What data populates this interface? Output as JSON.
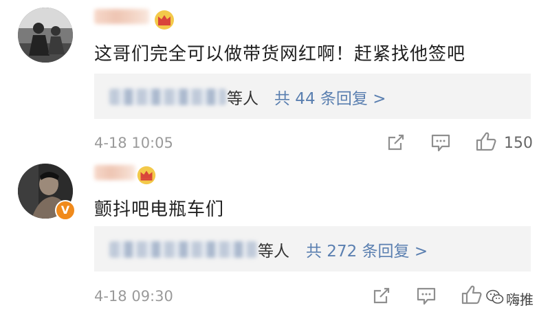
{
  "comments": [
    {
      "text": "这哥们完全可以做带货网红啊！赶紧找他签吧",
      "reply_suffix": "等人",
      "reply_count": "共 44 条回复 >",
      "timestamp": "4-18 10:05",
      "like_count": "150",
      "has_verified_badge": false
    },
    {
      "text": "颤抖吧电瓶车们",
      "reply_suffix": "等人",
      "reply_count": "共 272 条回复 >",
      "timestamp": "4-18 09:30",
      "like_count": "",
      "has_verified_badge": true,
      "badge_letter": "V"
    }
  ],
  "watermark": {
    "text": "嗨推",
    "icon": "wechat-icon"
  },
  "icons": {
    "crown": "crown-icon",
    "share": "share-icon",
    "comment": "comment-icon",
    "like": "like-icon"
  },
  "colors": {
    "link_blue": "#5a7fb0",
    "reply_bg": "#f3f3f3",
    "timestamp_gray": "#9a9a9a",
    "crown_gold": "#e8b52a",
    "crown_red": "#d9453a",
    "verified_orange": "#f08a1c"
  }
}
